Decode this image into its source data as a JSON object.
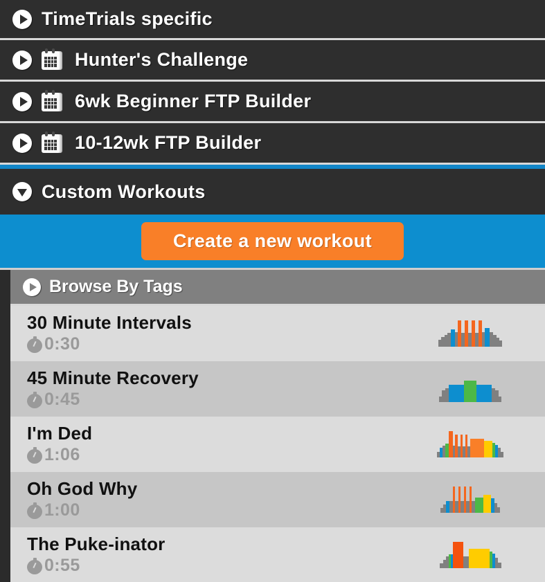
{
  "theme": {
    "dark_bg": "#2e2e2e",
    "accent_blue": "#0d8ecf",
    "accent_orange": "#f97f28",
    "row_light": "#dcdcdc",
    "row_dark": "#c6c6c6",
    "tag_gray": "#808080",
    "divider": "#d8d8d8"
  },
  "header_rows": [
    {
      "label": "TimeTrials specific",
      "icon": "play-triangle-icon",
      "has_calendar": false,
      "expanded": false
    },
    {
      "label": "Hunter's Challenge",
      "icon": "play-triangle-icon",
      "calendar_icon": "calendar-icon",
      "has_calendar": true,
      "expanded": false
    },
    {
      "label": "6wk Beginner FTP Builder",
      "icon": "play-triangle-icon",
      "calendar_icon": "calendar-icon",
      "has_calendar": true,
      "expanded": false
    },
    {
      "label": "10-12wk FTP Builder",
      "icon": "play-triangle-icon",
      "calendar_icon": "calendar-icon",
      "has_calendar": true,
      "expanded": false
    }
  ],
  "custom_section": {
    "label": "Custom Workouts",
    "icon": "collapse-triangle-down-icon",
    "expanded": true,
    "create_button_label": "Create a new workout",
    "browse_tags_label": "Browse By Tags",
    "browse_tags_icon": "play-triangle-icon"
  },
  "workouts": [
    {
      "name": "30 Minute Intervals",
      "duration": "0:30",
      "duration_icon": "stopwatch-icon",
      "profile": [
        {
          "w": 4,
          "h": 26,
          "c": "#808080"
        },
        {
          "w": 5,
          "h": 38,
          "c": "#808080"
        },
        {
          "w": 4,
          "h": 46,
          "c": "#808080"
        },
        {
          "w": 5,
          "h": 52,
          "c": "#808080"
        },
        {
          "w": 6,
          "h": 66,
          "c": "#0d8ecf"
        },
        {
          "w": 4,
          "h": 56,
          "c": "#808080"
        },
        {
          "w": 5,
          "h": 100,
          "c": "#f4661e"
        },
        {
          "w": 5,
          "h": 52,
          "c": "#808080"
        },
        {
          "w": 5,
          "h": 100,
          "c": "#f4661e"
        },
        {
          "w": 5,
          "h": 52,
          "c": "#808080"
        },
        {
          "w": 5,
          "h": 100,
          "c": "#f4661e"
        },
        {
          "w": 5,
          "h": 52,
          "c": "#808080"
        },
        {
          "w": 5,
          "h": 100,
          "c": "#f4661e"
        },
        {
          "w": 4,
          "h": 54,
          "c": "#808080"
        },
        {
          "w": 7,
          "h": 72,
          "c": "#0d8ecf"
        },
        {
          "w": 5,
          "h": 56,
          "c": "#808080"
        },
        {
          "w": 5,
          "h": 46,
          "c": "#808080"
        },
        {
          "w": 4,
          "h": 34,
          "c": "#808080"
        },
        {
          "w": 4,
          "h": 24,
          "c": "#808080"
        }
      ]
    },
    {
      "name": "45 Minute Recovery",
      "duration": "0:45",
      "duration_icon": "stopwatch-icon",
      "profile": [
        {
          "w": 4,
          "h": 22,
          "c": "#808080"
        },
        {
          "w": 5,
          "h": 44,
          "c": "#808080"
        },
        {
          "w": 5,
          "h": 52,
          "c": "#808080"
        },
        {
          "w": 22,
          "h": 66,
          "c": "#0d8ecf"
        },
        {
          "w": 18,
          "h": 82,
          "c": "#4cb847"
        },
        {
          "w": 22,
          "h": 66,
          "c": "#0d8ecf"
        },
        {
          "w": 5,
          "h": 52,
          "c": "#808080"
        },
        {
          "w": 5,
          "h": 44,
          "c": "#808080"
        },
        {
          "w": 4,
          "h": 22,
          "c": "#808080"
        }
      ]
    },
    {
      "name": "I'm Ded",
      "duration": "1:06",
      "duration_icon": "stopwatch-icon",
      "profile": [
        {
          "w": 4,
          "h": 20,
          "c": "#808080"
        },
        {
          "w": 4,
          "h": 36,
          "c": "#0d8ecf"
        },
        {
          "w": 4,
          "h": 46,
          "c": "#808080"
        },
        {
          "w": 5,
          "h": 52,
          "c": "#4cb847"
        },
        {
          "w": 6,
          "h": 100,
          "c": "#f4661e"
        },
        {
          "w": 4,
          "h": 44,
          "c": "#808080"
        },
        {
          "w": 4,
          "h": 88,
          "c": "#f4661e"
        },
        {
          "w": 4,
          "h": 42,
          "c": "#808080"
        },
        {
          "w": 3,
          "h": 88,
          "c": "#f4661e"
        },
        {
          "w": 4,
          "h": 42,
          "c": "#808080"
        },
        {
          "w": 3,
          "h": 88,
          "c": "#f4661e"
        },
        {
          "w": 4,
          "h": 42,
          "c": "#808080"
        },
        {
          "w": 20,
          "h": 70,
          "c": "#f97f28"
        },
        {
          "w": 13,
          "h": 64,
          "c": "#ffcc00"
        },
        {
          "w": 4,
          "h": 56,
          "c": "#4cb847"
        },
        {
          "w": 4,
          "h": 48,
          "c": "#0d8ecf"
        },
        {
          "w": 4,
          "h": 36,
          "c": "#808080"
        },
        {
          "w": 4,
          "h": 20,
          "c": "#808080"
        }
      ]
    },
    {
      "name": "Oh God Why",
      "duration": "1:00",
      "duration_icon": "stopwatch-icon",
      "profile": [
        {
          "w": 4,
          "h": 18,
          "c": "#808080"
        },
        {
          "w": 4,
          "h": 32,
          "c": "#808080"
        },
        {
          "w": 5,
          "h": 44,
          "c": "#0d8ecf"
        },
        {
          "w": 5,
          "h": 46,
          "c": "#808080"
        },
        {
          "w": 3,
          "h": 100,
          "c": "#f4661e"
        },
        {
          "w": 5,
          "h": 46,
          "c": "#808080"
        },
        {
          "w": 3,
          "h": 100,
          "c": "#f4661e"
        },
        {
          "w": 5,
          "h": 46,
          "c": "#808080"
        },
        {
          "w": 3,
          "h": 100,
          "c": "#f4661e"
        },
        {
          "w": 5,
          "h": 46,
          "c": "#808080"
        },
        {
          "w": 3,
          "h": 100,
          "c": "#f4661e"
        },
        {
          "w": 5,
          "h": 46,
          "c": "#808080"
        },
        {
          "w": 12,
          "h": 58,
          "c": "#4cb847"
        },
        {
          "w": 11,
          "h": 68,
          "c": "#ffcc00"
        },
        {
          "w": 5,
          "h": 54,
          "c": "#0d8ecf"
        },
        {
          "w": 4,
          "h": 38,
          "c": "#808080"
        },
        {
          "w": 4,
          "h": 20,
          "c": "#808080"
        }
      ]
    },
    {
      "name": "The Puke-inator",
      "duration": "0:55",
      "duration_icon": "stopwatch-icon",
      "profile": [
        {
          "w": 5,
          "h": 18,
          "c": "#808080"
        },
        {
          "w": 4,
          "h": 32,
          "c": "#808080"
        },
        {
          "w": 4,
          "h": 44,
          "c": "#808080"
        },
        {
          "w": 3,
          "h": 52,
          "c": "#4cb847"
        },
        {
          "w": 3,
          "h": 52,
          "c": "#0d8ecf"
        },
        {
          "w": 15,
          "h": 100,
          "c": "#f4520e"
        },
        {
          "w": 8,
          "h": 46,
          "c": "#808080"
        },
        {
          "w": 30,
          "h": 74,
          "c": "#ffcc00"
        },
        {
          "w": 4,
          "h": 62,
          "c": "#4cb847"
        },
        {
          "w": 4,
          "h": 56,
          "c": "#0d8ecf"
        },
        {
          "w": 4,
          "h": 40,
          "c": "#808080"
        },
        {
          "w": 5,
          "h": 20,
          "c": "#808080"
        }
      ]
    }
  ]
}
